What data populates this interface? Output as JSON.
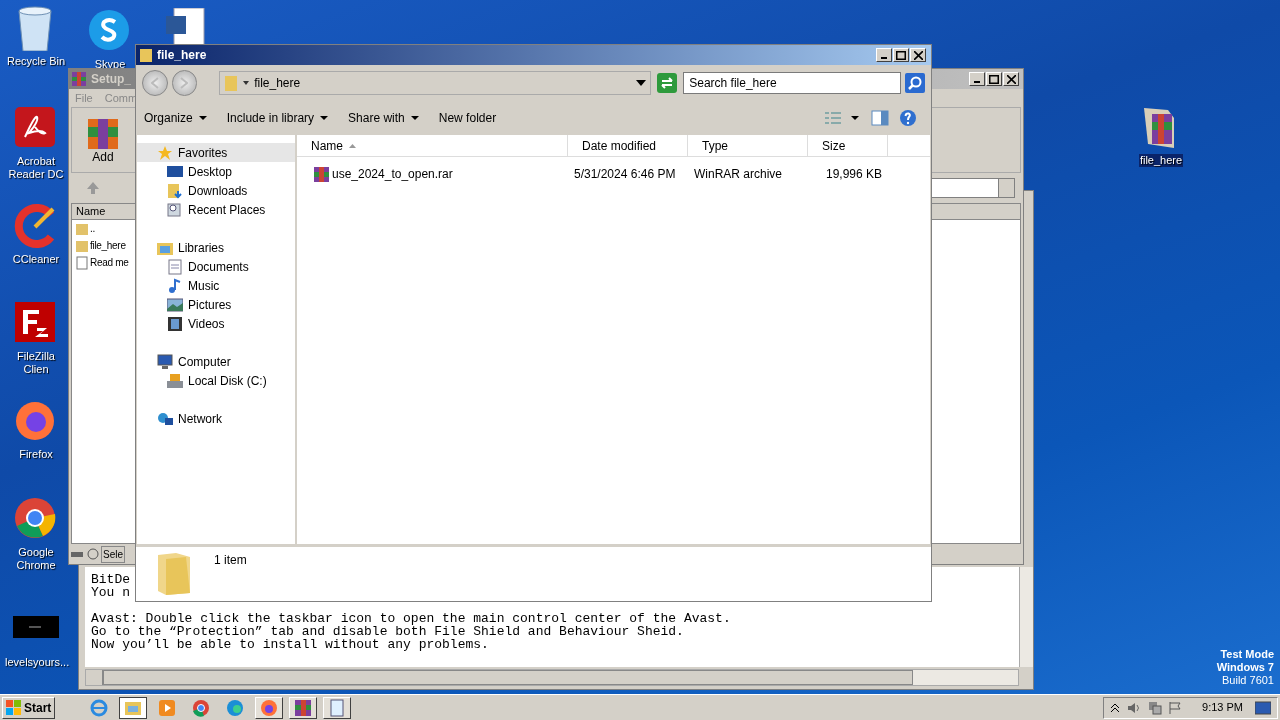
{
  "desktop": {
    "icons": [
      {
        "label": "Recycle Bin",
        "kind": "recycle",
        "selected": false
      },
      {
        "label": "Skype",
        "kind": "skype",
        "selected": false
      },
      {
        "label": "Acrobat Reader DC",
        "kind": "acrobat",
        "selected": false
      },
      {
        "label": "CCleaner",
        "kind": "ccleaner",
        "selected": false
      },
      {
        "label": "FileZilla Clien",
        "kind": "filezilla",
        "selected": false
      },
      {
        "label": "Firefox",
        "kind": "firefox",
        "selected": false
      },
      {
        "label": "Google Chrome",
        "kind": "chrome",
        "selected": false
      },
      {
        "label": "levelsyours...",
        "kind": "blackimage",
        "selected": false
      },
      {
        "label": "file_here",
        "kind": "rarfolder",
        "selected": true
      }
    ],
    "os_notice": [
      "Test Mode",
      "Windows 7",
      "Build 7601"
    ]
  },
  "notepad": {
    "paragraphs": [
      [
        "BitDe",
        "You n"
      ],
      [
        "Avast: Double click the taskbar icon to open the main control center of the Avast.",
        "Go to the “Protection” tab and disable both File Shield and Behaviour Sheid.",
        "Now you’ll be able to install without any problems."
      ]
    ]
  },
  "winrar": {
    "title": "Setup_",
    "menu": [
      "File",
      "Comm"
    ],
    "toolbar": [
      {
        "label": "Add"
      }
    ],
    "columns": [
      "Name"
    ],
    "rows": [
      {
        "name": "..",
        "kind": "up"
      },
      {
        "name": "file_here",
        "kind": "folder"
      },
      {
        "name": "Read me",
        "kind": "text"
      }
    ],
    "status": "Sele"
  },
  "explorer": {
    "title": "file_here",
    "address": "file_here",
    "search": {
      "placeholder": "Search file_here"
    },
    "commands": [
      {
        "label": "Organize",
        "has_menu": true
      },
      {
        "label": "Include in library",
        "has_menu": true
      },
      {
        "label": "Share with",
        "has_menu": true
      },
      {
        "label": "New folder",
        "has_menu": false
      }
    ],
    "nav": [
      {
        "label": "Favorites",
        "kind": "star",
        "selected": true,
        "children": [
          {
            "label": "Desktop",
            "kind": "desktop",
            "selected": false
          },
          {
            "label": "Downloads",
            "kind": "downloads",
            "selected": false
          },
          {
            "label": "Recent Places",
            "kind": "recent",
            "selected": false
          }
        ]
      },
      {
        "label": "Libraries",
        "kind": "libraries",
        "selected": false,
        "children": [
          {
            "label": "Documents",
            "kind": "documents",
            "selected": false
          },
          {
            "label": "Music",
            "kind": "music",
            "selected": false
          },
          {
            "label": "Pictures",
            "kind": "pictures",
            "selected": false
          },
          {
            "label": "Videos",
            "kind": "videos",
            "selected": false
          }
        ]
      },
      {
        "label": "Computer",
        "kind": "computer",
        "selected": false,
        "children": [
          {
            "label": "Local Disk (C:)",
            "kind": "disk",
            "selected": false
          }
        ]
      },
      {
        "label": "Network",
        "kind": "network",
        "selected": false
      }
    ],
    "columns": [
      {
        "label": "Name",
        "sorted": true
      },
      {
        "label": "Date modified",
        "sorted": false
      },
      {
        "label": "Type",
        "sorted": false
      },
      {
        "label": "Size",
        "sorted": false
      }
    ],
    "rows": [
      {
        "name": "use_2024_to_open.rar",
        "date": "5/31/2024 6:46 PM",
        "type": "WinRAR archive",
        "size": "19,996 KB"
      }
    ],
    "status": "1 item"
  },
  "taskbar": {
    "start": "Start",
    "apps": [
      {
        "kind": "ie",
        "running": false,
        "active": false
      },
      {
        "kind": "explorer",
        "running": true,
        "active": true
      },
      {
        "kind": "media",
        "running": false,
        "active": false
      },
      {
        "kind": "chrome",
        "running": false,
        "active": false
      },
      {
        "kind": "edge",
        "running": false,
        "active": false
      },
      {
        "kind": "firefox",
        "running": true,
        "active": false
      },
      {
        "kind": "winrar",
        "running": true,
        "active": false
      },
      {
        "kind": "notepad",
        "running": true,
        "active": false
      }
    ],
    "clock": "9:13 PM"
  }
}
